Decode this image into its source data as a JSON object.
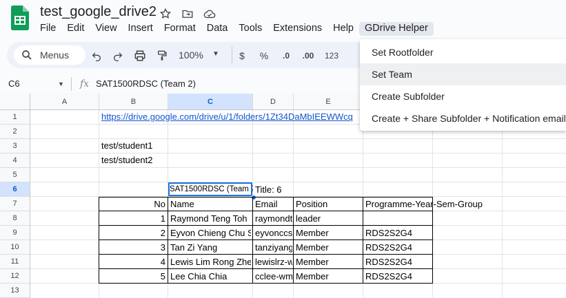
{
  "doc": {
    "title": "test_google_drive2"
  },
  "menu": [
    "File",
    "Edit",
    "View",
    "Insert",
    "Format",
    "Data",
    "Tools",
    "Extensions",
    "Help",
    "GDrive Helper"
  ],
  "toolbar": {
    "search_label": "Menus",
    "zoom": "100%",
    "currency": "$",
    "percent": "%",
    "dec_less": ".0",
    "dec_more": ".00",
    "number_format": "123"
  },
  "formula_bar": {
    "cell_ref": "C6",
    "fx": "fx",
    "value": "SAT1500RDSC (Team 2)"
  },
  "columns": [
    "A",
    "B",
    "C",
    "D",
    "E"
  ],
  "rows": [
    "1",
    "2",
    "3",
    "4",
    "5",
    "6",
    "7",
    "8",
    "9",
    "10",
    "11",
    "12",
    "13"
  ],
  "cells": {
    "b1": "https://drive.google.com/drive/u/1/folders/1Zt34DaMbIEEWWcq",
    "b3": "test/student1",
    "b4": "test/student2",
    "c6": "SAT1500RDSC (Team 2)",
    "d6": "Title: 6",
    "header": {
      "no": "No",
      "name": "Name",
      "email": "Email",
      "position": "Position",
      "group": "Programme-Year-Sem-Group"
    },
    "data": [
      {
        "no": "1",
        "name": "Raymond Teng Toh",
        "email": "raymondt",
        "position": "leader",
        "group": ""
      },
      {
        "no": "2",
        "name": "Eyvon Chieng Chu S",
        "email": "eyvonccs",
        "position": "Member",
        "group": "RDS2S2G4"
      },
      {
        "no": "3",
        "name": "Tan Zi Yang",
        "email": "tanziyang",
        "position": "Member",
        "group": "RDS2S2G4"
      },
      {
        "no": "4",
        "name": "Lewis Lim Rong Zhe",
        "email": "lewislrz-w",
        "position": "Member",
        "group": "RDS2S2G4"
      },
      {
        "no": "5",
        "name": "Lee Chia Chia",
        "email": "cclee-wm",
        "position": "Member",
        "group": "RDS2S2G4"
      }
    ]
  },
  "gdrive_menu": [
    "Set Rootfolder",
    "Set Team",
    "Create Subfolder",
    "Create + Share Subfolder + Notification email"
  ]
}
